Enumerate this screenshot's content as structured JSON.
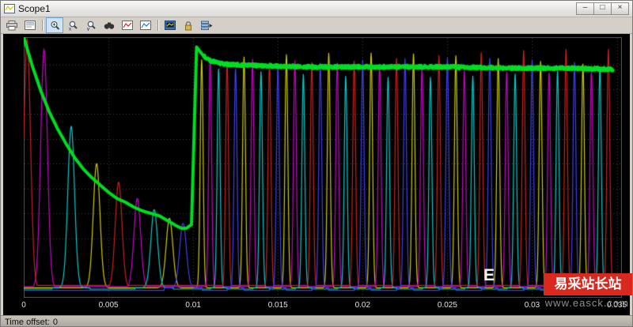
{
  "window": {
    "title": "Scope1",
    "buttons": {
      "minimize": "–",
      "maximize": "□",
      "close": "×"
    }
  },
  "toolbar": {
    "icons": [
      {
        "name": "print-icon"
      },
      {
        "name": "parameters-icon"
      },
      {
        "name": "zoom-icon",
        "active": true
      },
      {
        "name": "zoom-x-icon"
      },
      {
        "name": "zoom-y-icon"
      },
      {
        "name": "autoscale-binoculars-icon"
      },
      {
        "name": "save-axes-icon"
      },
      {
        "name": "restore-axes-icon"
      },
      {
        "name": "floating-scope-icon"
      },
      {
        "name": "lock-axes-icon"
      },
      {
        "name": "signal-selection-icon"
      }
    ]
  },
  "statusbar": {
    "time_offset_label": "Time offset:",
    "time_offset_value": "0"
  },
  "watermark": {
    "box_text": "易采站长站",
    "url_text": "www.easck.com",
    "letter": "E",
    "box_color": "#d9281e"
  },
  "chart_data": {
    "type": "line",
    "title": "",
    "xlabel": "",
    "ylabel": "",
    "xlim": [
      0,
      0.0353
    ],
    "ylim": [
      -0.08,
      2.02
    ],
    "x_ticks": [
      "0",
      "0.005",
      "0.01",
      "0.015",
      "0.02",
      "0.025",
      "0.03",
      "0.035"
    ],
    "y_ticks": [
      "0.4",
      "0.6",
      "0.8",
      "1",
      "1.2",
      "1.4",
      "1.6",
      "1.8"
    ],
    "background": "#000000",
    "grid": true,
    "grid_color": "#3f3f3f",
    "green_trace": {
      "color": "#00dd22",
      "width": 4,
      "noise": 0.013,
      "noise_after": 0.0106,
      "points": [
        [
          0,
          2.02
        ],
        [
          0.0005,
          1.79
        ],
        [
          0.001,
          1.59
        ],
        [
          0.0015,
          1.42
        ],
        [
          0.002,
          1.28
        ],
        [
          0.0025,
          1.16
        ],
        [
          0.003,
          1.05
        ],
        [
          0.0035,
          0.96
        ],
        [
          0.004,
          0.89
        ],
        [
          0.0045,
          0.83
        ],
        [
          0.005,
          0.77
        ],
        [
          0.0055,
          0.72
        ],
        [
          0.006,
          0.69
        ],
        [
          0.0065,
          0.65
        ],
        [
          0.007,
          0.62
        ],
        [
          0.0075,
          0.6
        ],
        [
          0.008,
          0.58
        ],
        [
          0.0085,
          0.54
        ],
        [
          0.009,
          0.5
        ],
        [
          0.0093,
          0.48
        ],
        [
          0.0096,
          0.48
        ],
        [
          0.0099,
          0.51
        ],
        [
          0.0102,
          1.94
        ],
        [
          0.0106,
          1.87
        ],
        [
          0.011,
          1.83
        ],
        [
          0.0115,
          1.81
        ],
        [
          0.012,
          1.8
        ],
        [
          0.014,
          1.79
        ],
        [
          0.017,
          1.78
        ],
        [
          0.021,
          1.78
        ],
        [
          0.025,
          1.78
        ],
        [
          0.029,
          1.77
        ],
        [
          0.032,
          1.77
        ],
        [
          0.0348,
          1.76
        ]
      ]
    },
    "pulse_trains": {
      "colors": [
        "#cccc00",
        "#cc00cc",
        "#00cccc",
        "#cc2020",
        "#4040ee"
      ],
      "baseline_offsets": [
        0.0,
        0.01,
        -0.01,
        0.02,
        -0.02
      ],
      "pre_width": 0.00028,
      "pre_pulses": [
        {
          "t": 0.0002,
          "ch": 3,
          "a": 2.0
        },
        {
          "t": 0.0012,
          "ch": 1,
          "a": 1.92
        },
        {
          "t": 0.0028,
          "ch": 2,
          "a": 1.3
        },
        {
          "t": 0.0043,
          "ch": 0,
          "a": 1.0
        },
        {
          "t": 0.0056,
          "ch": 3,
          "a": 0.85
        },
        {
          "t": 0.0067,
          "ch": 1,
          "a": 0.72
        },
        {
          "t": 0.0077,
          "ch": 2,
          "a": 0.63
        },
        {
          "t": 0.0086,
          "ch": 0,
          "a": 0.56
        },
        {
          "t": 0.0094,
          "ch": 4,
          "a": 0.52
        }
      ],
      "post": {
        "t_start": 0.0105,
        "t_end": 0.0349,
        "period": 0.0025,
        "width": 0.00012,
        "amplitudes": [
          1.84,
          1.79,
          1.75,
          1.87,
          1.8
        ]
      }
    }
  }
}
